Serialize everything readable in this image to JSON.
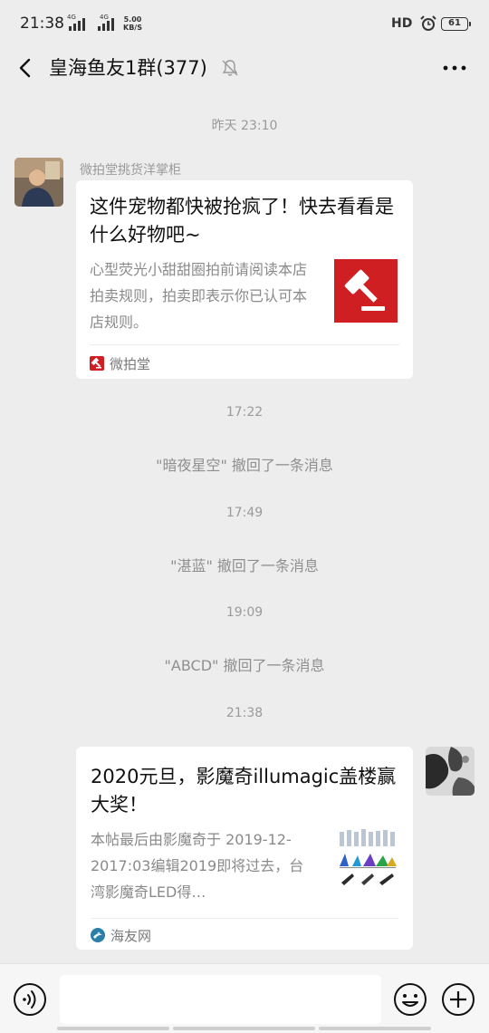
{
  "status_bar": {
    "time": "21:38",
    "sim1_label": "4G",
    "sim2_label": "4G",
    "speed_value": "5.00",
    "speed_unit": "KB/S",
    "hd_label": "HD",
    "battery": "61"
  },
  "header": {
    "title": "皇海鱼友1群(377)",
    "icons": [
      "back-arrow-icon",
      "mute-bell-icon",
      "more-icon"
    ]
  },
  "messages": {
    "time_yesterday": "昨天 23:10",
    "card1": {
      "sender": "微拍堂挑货洋掌柜",
      "title": "这件宠物都快被抢疯了！快去看看是什么好物吧~",
      "description": "心型荧光小甜甜圈拍前请阅读本店拍卖规则，拍卖即表示你已认可本店规则。",
      "source": "微拍堂",
      "thumb_color": "#cf1f23"
    },
    "time_1": "17:22",
    "recall_1": "\"暗夜星空\" 撤回了一条消息",
    "time_2": "17:49",
    "recall_2": "\"湛蓝\" 撤回了一条消息",
    "time_3": "19:09",
    "recall_3": "\"ABCD\" 撤回了一条消息",
    "time_4": "21:38",
    "card2": {
      "title": "2020元旦，影魔奇illumagic盖楼赢大奖！",
      "description": "本帖最后由影魔奇于 2019-12-2017:03编辑2019即将过去，台湾影魔奇LED得…",
      "source": "海友网"
    }
  },
  "input_bar": {
    "icons": [
      "voice-icon",
      "emoji-icon",
      "plus-icon"
    ]
  }
}
